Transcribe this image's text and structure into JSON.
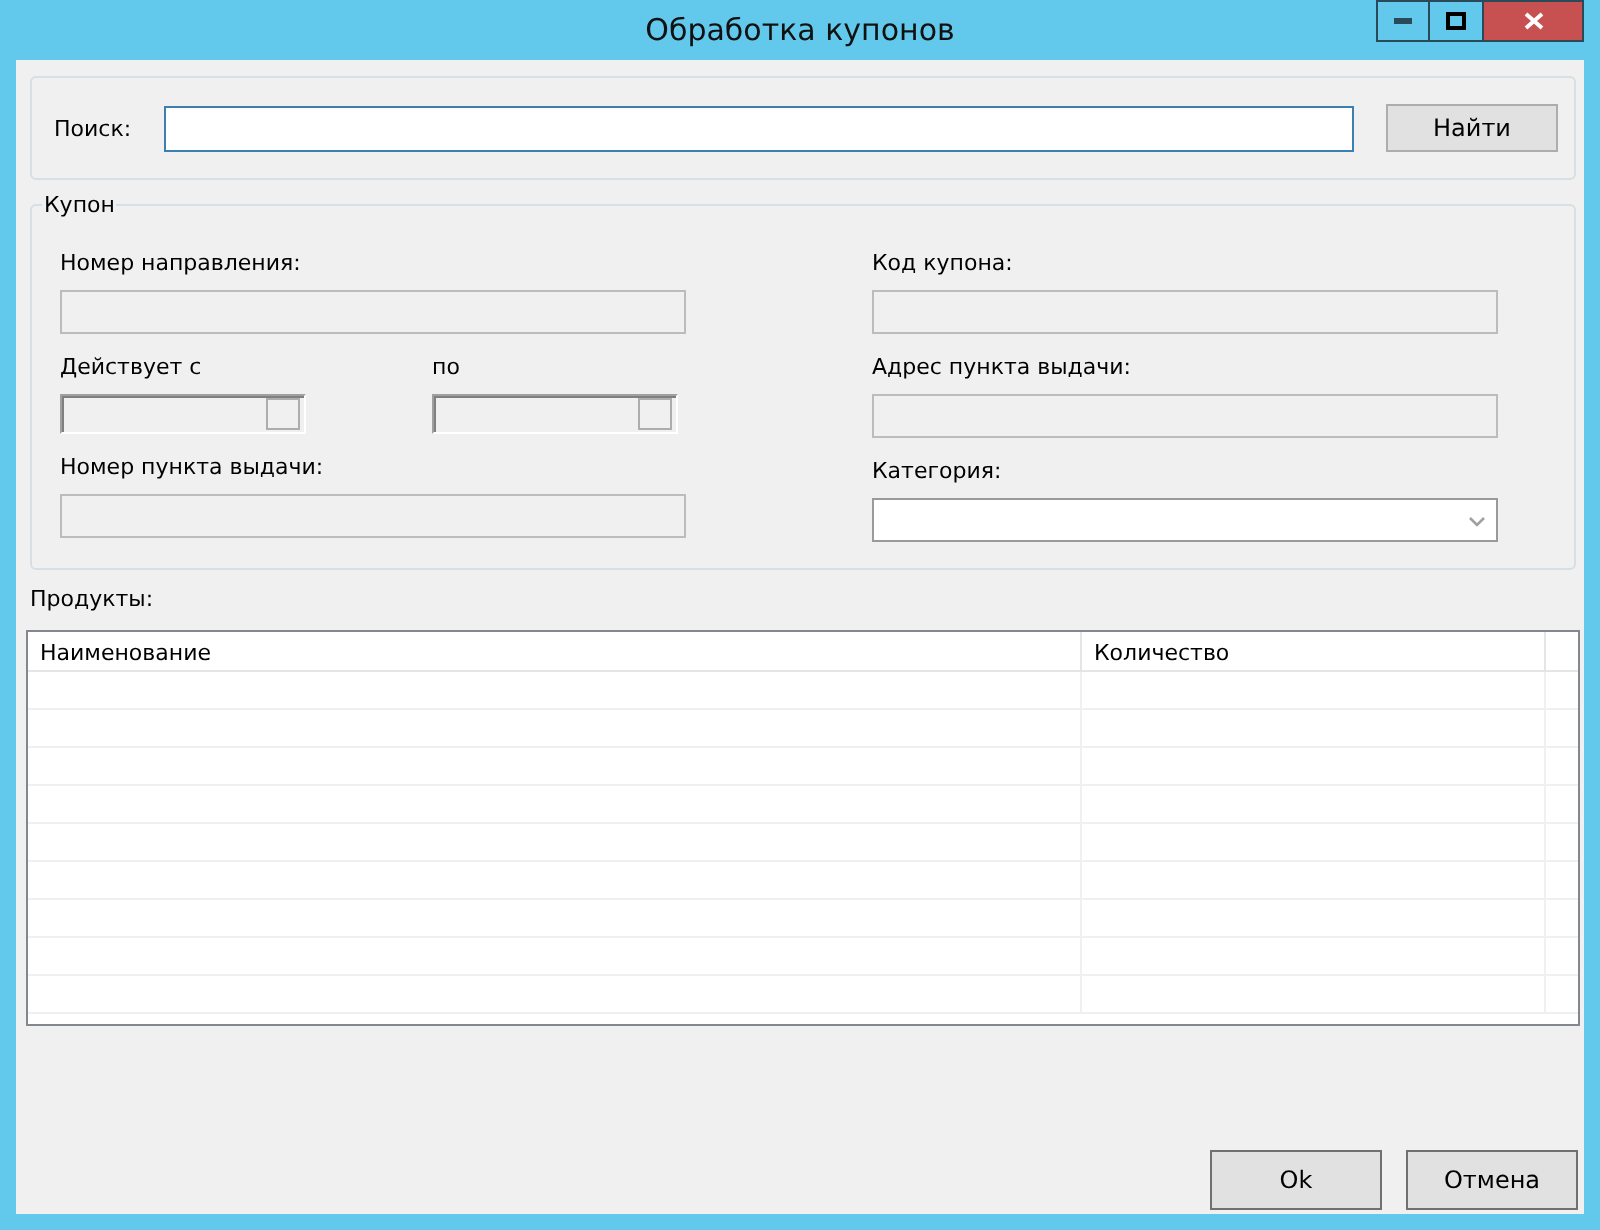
{
  "window": {
    "title": "Обработка купонов"
  },
  "search": {
    "label": "Поиск:",
    "button": "Найти"
  },
  "coupon": {
    "title": "Купон",
    "left": [
      {
        "kind": "text",
        "label": "Номер направления:",
        "disabled": true
      },
      {
        "kind": "dates",
        "from_label": "Действует с",
        "to_label": "по",
        "disabled": true
      },
      {
        "kind": "text",
        "label": "Номер пункта выдачи:",
        "disabled": true
      }
    ],
    "right": [
      {
        "kind": "text",
        "label": "Код купона:",
        "disabled": true
      },
      {
        "kind": "text",
        "label": "Адрес пункта выдачи:",
        "disabled": true
      },
      {
        "kind": "select",
        "label": "Категория:",
        "disabled": false
      }
    ]
  },
  "products": {
    "label": "Продукты:",
    "columns": [
      "Наименование",
      "Количество"
    ]
  },
  "buttons": [
    "Ok",
    "Отмена"
  ]
}
